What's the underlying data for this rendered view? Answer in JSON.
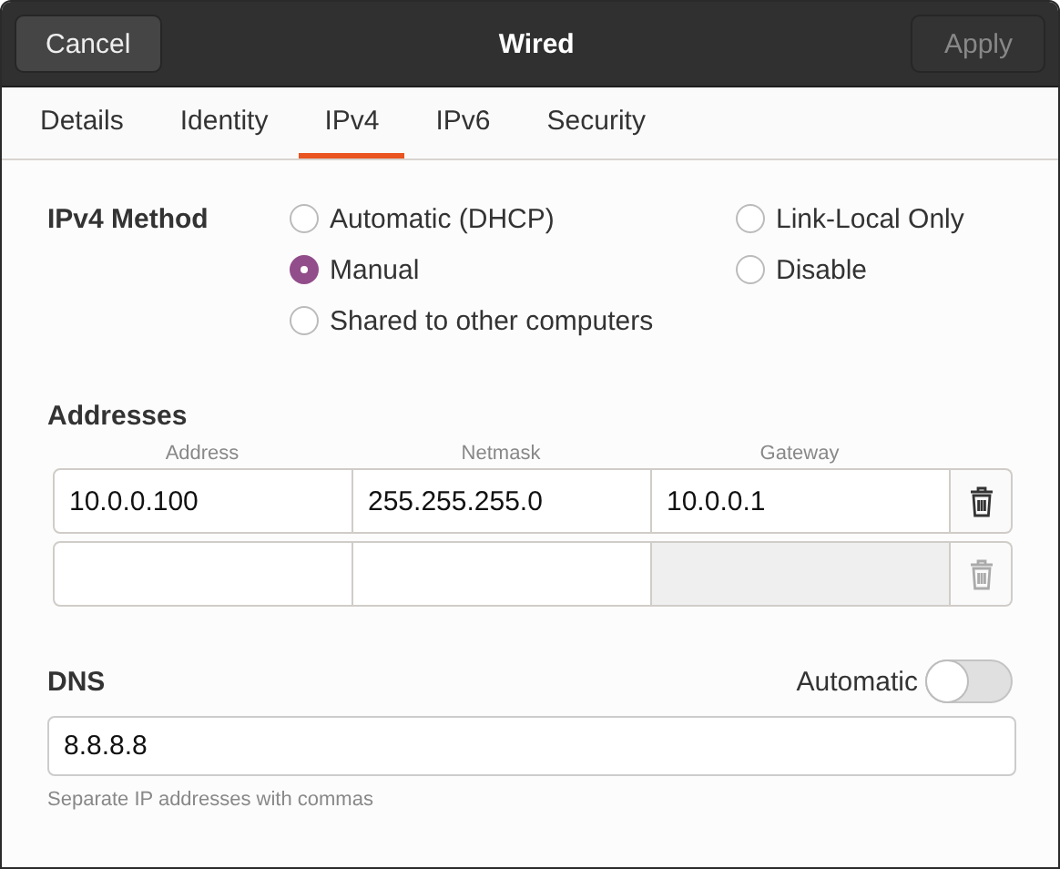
{
  "header": {
    "cancel": "Cancel",
    "title": "Wired",
    "apply": "Apply",
    "apply_disabled": true
  },
  "tabs": [
    {
      "label": "Details",
      "selected": false
    },
    {
      "label": "Identity",
      "selected": false
    },
    {
      "label": "IPv4",
      "selected": true
    },
    {
      "label": "IPv6",
      "selected": false
    },
    {
      "label": "Security",
      "selected": false
    }
  ],
  "method": {
    "label": "IPv4 Method",
    "options": [
      {
        "label": "Automatic (DHCP)",
        "selected": false
      },
      {
        "label": "Link-Local Only",
        "selected": false
      },
      {
        "label": "Manual",
        "selected": true
      },
      {
        "label": "Disable",
        "selected": false
      },
      {
        "label": "Shared to other computers",
        "selected": false
      }
    ]
  },
  "addresses": {
    "title": "Addresses",
    "columns": [
      "Address",
      "Netmask",
      "Gateway"
    ],
    "rows": [
      {
        "address": "10.0.0.100",
        "netmask": "255.255.255.0",
        "gateway": "10.0.0.1",
        "gateway_disabled": false,
        "delete_disabled": false
      },
      {
        "gateway_disabled": true,
        "delete_disabled": true
      }
    ]
  },
  "dns": {
    "title": "DNS",
    "automatic_label": "Automatic",
    "automatic_on": false,
    "value": "8.8.8.8",
    "hint": "Separate IP addresses with commas"
  }
}
